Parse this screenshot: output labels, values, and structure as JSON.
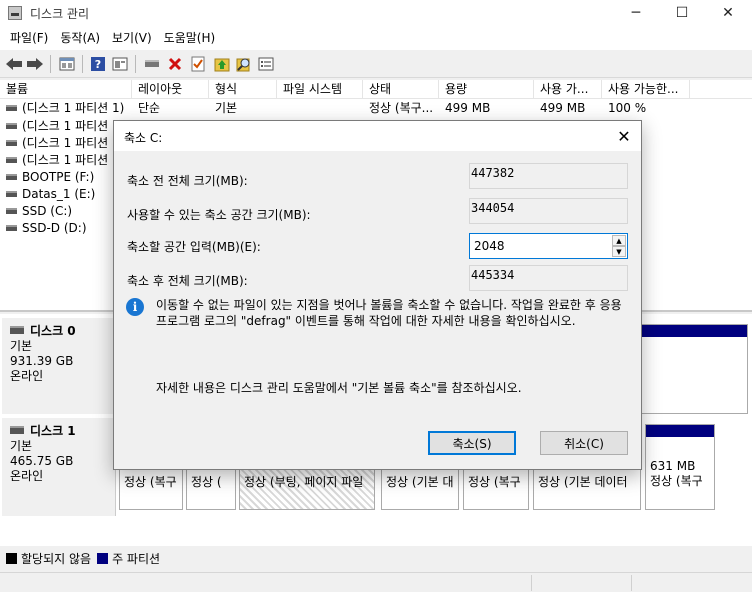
{
  "window": {
    "title": "디스크 관리",
    "minimize_glyph": "─",
    "maximize_glyph": "☐",
    "close_glyph": "✕"
  },
  "menu": [
    "파일(F)",
    "동작(A)",
    "보기(V)",
    "도움말(H)"
  ],
  "toolbar_icons": [
    "back-arrow-icon",
    "forward-arrow-icon",
    "properties-icon",
    "help-icon",
    "console-icon",
    "connect-icon",
    "delete-icon",
    "check-icon",
    "up-icon",
    "search-icon",
    "list-icon"
  ],
  "volume_list": {
    "columns": [
      "볼륨",
      "레이아웃",
      "형식",
      "파일 시스템",
      "상태",
      "용량",
      "사용 가...",
      "사용 가능한..."
    ],
    "rows": [
      {
        "volume": "(디스크 1 파티션 1)",
        "layout": "단순",
        "type": "기본",
        "fs": "",
        "status": "정상 (복구...",
        "capacity": "499 MB",
        "free": "499 MB",
        "pct": "100 %"
      },
      {
        "volume": "(디스크 1 파티션",
        "layout": "",
        "type": "",
        "fs": "",
        "status": "",
        "capacity": "",
        "free": "",
        "pct": ""
      },
      {
        "volume": "(디스크 1 파티션",
        "layout": "",
        "type": "",
        "fs": "",
        "status": "",
        "capacity": "",
        "free": "",
        "pct": ""
      },
      {
        "volume": "(디스크 1 파티션",
        "layout": "",
        "type": "",
        "fs": "",
        "status": "",
        "capacity": "",
        "free": "",
        "pct": ""
      },
      {
        "volume": "BOOTPE (F:)",
        "layout": "",
        "type": "",
        "fs": "",
        "status": "",
        "capacity": "",
        "free": "",
        "pct": ""
      },
      {
        "volume": "Datas_1 (E:)",
        "layout": "",
        "type": "",
        "fs": "",
        "status": "",
        "capacity": "",
        "free": "",
        "pct": ""
      },
      {
        "volume": "SSD (C:)",
        "layout": "",
        "type": "",
        "fs": "",
        "status": "",
        "capacity": "",
        "free": "",
        "pct": ""
      },
      {
        "volume": "SSD-D (D:)",
        "layout": "",
        "type": "",
        "fs": "",
        "status": "",
        "capacity": "",
        "free": "",
        "pct": ""
      }
    ]
  },
  "disks": [
    {
      "name": "디스크 0",
      "type": "기본",
      "size": "931.39 GB",
      "state": "온라인"
    },
    {
      "name": "디스크 1",
      "type": "기본",
      "size": "465.75 GB",
      "state": "온라인"
    }
  ],
  "disk1_partitions": [
    "정상 (복구",
    "정상 (",
    "정상 (부팅, 페이지 파일",
    "정상 (기본 대",
    "정상 (복구",
    "정상 (기본 데이터",
    "정상 (복구"
  ],
  "disk1_last_partition_size": "631 MB",
  "legend": [
    {
      "label": "할당되지 않음",
      "color": "#000000"
    },
    {
      "label": "주 파티션",
      "color": "#00007f"
    }
  ],
  "dialog": {
    "title": "축소 C:",
    "total_before_label": "축소 전 전체 크기(MB):",
    "total_before_value": "447382",
    "available_label": "사용할 수 있는 축소 공간 크기(MB):",
    "available_value": "344054",
    "amount_label": "축소할 공간 입력(MB)(E):",
    "amount_value": "2048",
    "total_after_label": "축소 후 전체 크기(MB):",
    "total_after_value": "445334",
    "info_text": "이동할 수 없는 파일이 있는 지점을 벗어나 볼륨을 축소할 수 없습니다. 작업을 완료한 후 응용 프로그램 로그의 \"defrag\" 이벤트를 통해 작업에 대한 자세한 내용을 확인하십시오.",
    "help_text": "자세한 내용은 디스크 관리 도움말에서 \"기본 볼륨 축소\"를 참조하십시오.",
    "shrink_button": "축소(S)",
    "cancel_button": "취소(C)"
  }
}
